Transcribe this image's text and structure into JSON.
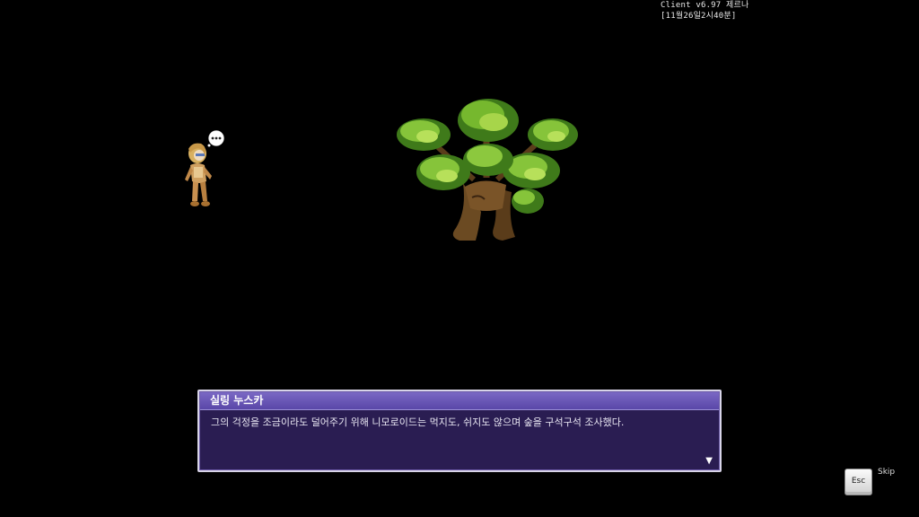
{
  "client_info": {
    "version_line": "Client v6.97 제르나",
    "timestamp_line": "[11월26일2시40분]"
  },
  "dialog": {
    "speaker": "실링 누스카",
    "text": "그의 걱정을 조금이라도 덜어주기 위해 니모로이드는 먹지도, 쉬지도 않으며 숲을 구석구석 조사했다.",
    "next_indicator": "▼"
  },
  "skip": {
    "key_label": "Esc",
    "label": "Skip"
  },
  "speech_bubble": {
    "icon": "ellipsis-icon",
    "text": "•••"
  }
}
